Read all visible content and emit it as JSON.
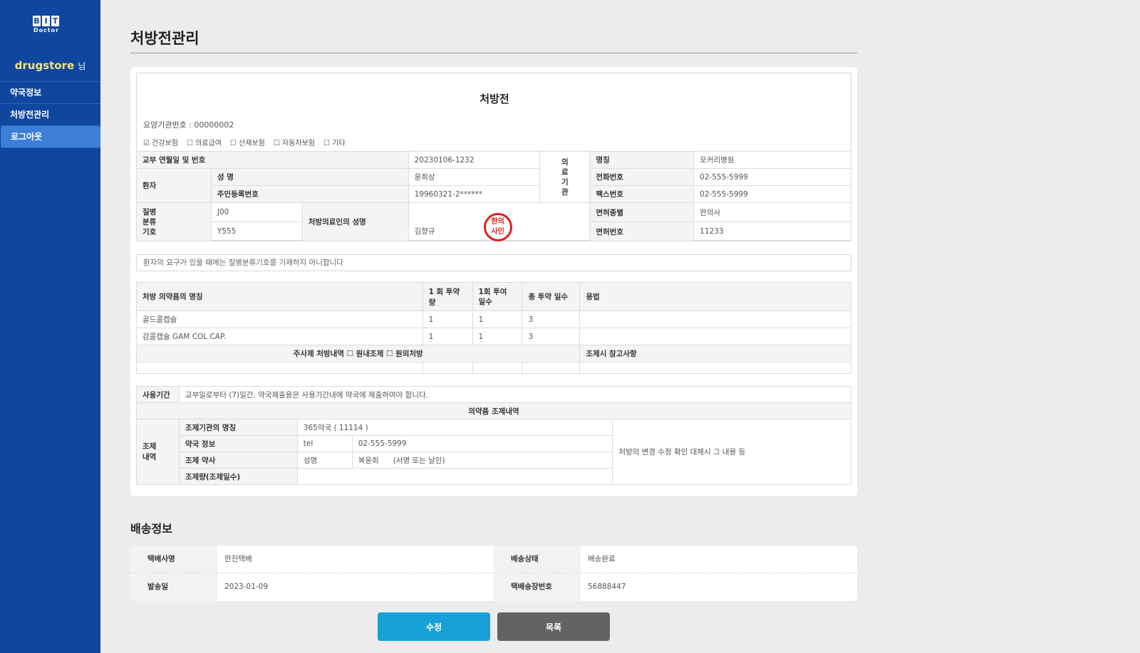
{
  "sidebar": {
    "logo_letters": [
      "B",
      "I",
      "T"
    ],
    "logo_sub": "Doctor",
    "user_name": "drugstore",
    "user_suffix": "님",
    "nav": [
      {
        "label": "약국정보"
      },
      {
        "label": "처방전관리"
      },
      {
        "label": "로그아웃",
        "active": true
      }
    ],
    "colors": {
      "background": "#0f479e",
      "active": "#3c7ed8",
      "username": "#f5e17a"
    }
  },
  "page": {
    "title": "처방전관리"
  },
  "prescription": {
    "title": "처방전",
    "institution_no": "요양기관번호 : 00000002",
    "insurance": [
      {
        "label": "☑ 건강보험"
      },
      {
        "label": "☐ 의료급여"
      },
      {
        "label": "☐ 산재보험"
      },
      {
        "label": "☐ 자동차보험"
      },
      {
        "label": "☐ 기타"
      }
    ],
    "issue_label": "교부 연월일 및 번호",
    "issue_value": "20230106-1232",
    "patient_label": "환자",
    "name_label": "성 명",
    "name_value": "윤희상",
    "rrn_label": "주민등록번호",
    "rrn_value": "19960321-2******",
    "hospital_vertical": [
      "의",
      "료",
      "기",
      "관"
    ],
    "hosp_name_label": "명칭",
    "hosp_name_value": "모커리병원",
    "phone_label": "전화번호",
    "phone_value": "02-555-5999",
    "fax_label": "팩스번호",
    "fax_value": "02-555-5999",
    "disease_vertical": [
      "질병",
      "분류",
      "기호"
    ],
    "disease_code1": "J00",
    "disease_code2": "Y555",
    "doctor_label": "처방의료인의 성명",
    "doctor_value": "김향규",
    "stamp_lines": [
      "한의",
      "사인"
    ],
    "license_type_label": "면허종별",
    "license_type_value": "한의사",
    "license_no_label": "면허번호",
    "license_no_value": "11233",
    "notice": "환자의 요구가 있을 때에는 질병분류기호를 기재하지 아니합니다",
    "drug_headers": {
      "name": "처방 의약품의 명칭",
      "dose": "1 회 투약량",
      "times_line1": "1회 투여",
      "times_line2": "일수",
      "days": "총 투약 일수",
      "usage": "용법"
    },
    "drugs": [
      {
        "name": "골드콜캡슐",
        "dose": "1",
        "times": "1",
        "days": "3",
        "usage": ""
      },
      {
        "name": "감콜캡슐 GAM COL CAP.",
        "dose": "1",
        "times": "1",
        "days": "3",
        "usage": ""
      }
    ],
    "injection_text": "주사제 처방내역 ☐ 원내조제 ☐ 원외처방",
    "dispensing_ref": "조제시 참고사항",
    "period_label": "사용기간",
    "period_text": "교부일로부터 (7)일간, 약국제출용은 사용기간내에 약국에 제출하여야 합니다.",
    "dispense_section_title": "의약품 조제내역",
    "dispense_vertical": [
      "조제",
      "내역"
    ],
    "pharmacy_name_label": "조제기관의 명칭",
    "pharmacy_name_value": "365약국 ( 11114 )",
    "pharmacy_info_label": "약국 정보",
    "tel_label": "tel",
    "tel_value": "02-555-5999",
    "pharmacist_label": "조제 약사",
    "pharmacist_name_label": "성명",
    "pharmacist_name_value": "복윤희",
    "pharmacist_sign": "(서명 또는 날인)",
    "dispense_amount_label": "조제량(조제일수)",
    "dispense_amount_value": "",
    "change_note": "처방의 변경 수정 확인 대체시 그 내용 등"
  },
  "shipping": {
    "title": "배송정보",
    "courier_label": "택배사명",
    "courier_value": "한진택배",
    "status_label": "배송상태",
    "status_value": "배송완료",
    "ship_date_label": "발송일",
    "ship_date_value": "2023-01-09",
    "tracking_label": "택배송장번호",
    "tracking_value": "56888447"
  },
  "buttons": {
    "edit": "수정",
    "list": "목록",
    "colors": {
      "edit": "#17a1d8",
      "list": "#636363"
    }
  }
}
